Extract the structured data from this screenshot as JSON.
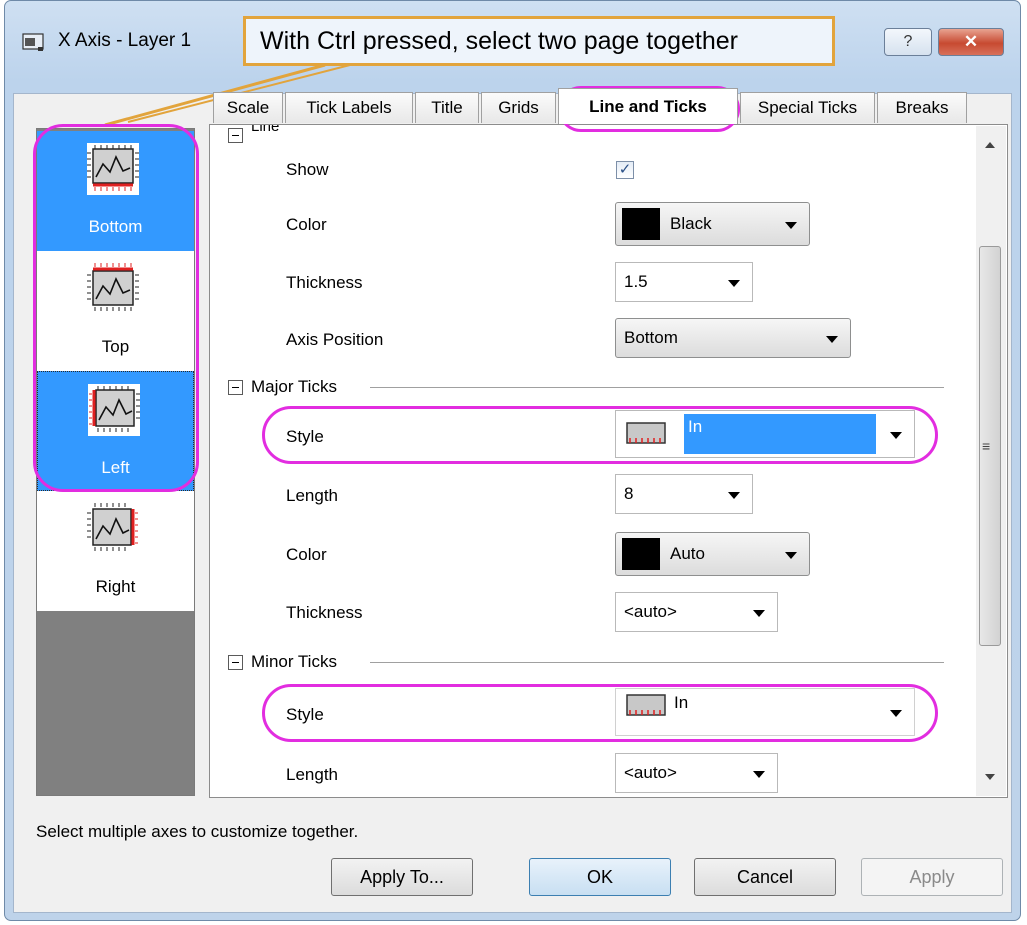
{
  "window": {
    "title": "X Axis - Layer 1",
    "help_label": "?",
    "close_label": "✕"
  },
  "callout": {
    "text": "With Ctrl pressed, select two page together"
  },
  "tabs": [
    {
      "label": "Scale"
    },
    {
      "label": "Tick Labels"
    },
    {
      "label": "Title"
    },
    {
      "label": "Grids"
    },
    {
      "label": "Line and Ticks",
      "active": true
    },
    {
      "label": "Special Ticks"
    },
    {
      "label": "Breaks"
    }
  ],
  "axes": [
    {
      "label": "Bottom",
      "selected": true,
      "icon": "axis-bottom-icon"
    },
    {
      "label": "Top",
      "selected": false,
      "icon": "axis-top-icon"
    },
    {
      "label": "Left",
      "selected": true,
      "icon": "axis-left-icon"
    },
    {
      "label": "Right",
      "selected": false,
      "icon": "axis-right-icon"
    }
  ],
  "line": {
    "header": "Line",
    "show_label": "Show",
    "show_checked": true,
    "color_label": "Color",
    "color_value": "Black",
    "thickness_label": "Thickness",
    "thickness_value": "1.5",
    "axis_position_label": "Axis Position",
    "axis_position_value": "Bottom"
  },
  "major": {
    "header": "Major Ticks",
    "style_label": "Style",
    "style_value": "In",
    "length_label": "Length",
    "length_value": "8",
    "color_label": "Color",
    "color_value": "Auto",
    "thickness_label": "Thickness",
    "thickness_value": "<auto>"
  },
  "minor": {
    "header": "Minor Ticks",
    "style_label": "Style",
    "style_value": "In",
    "length_label": "Length",
    "length_value": "<auto>"
  },
  "hint": "Select multiple axes to customize together.",
  "buttons": {
    "apply_to": "Apply To...",
    "ok": "OK",
    "cancel": "Cancel",
    "apply": "Apply"
  },
  "colors": {
    "selection": "#3399ff",
    "highlight": "#e22de0",
    "callout_border": "#e2a43c",
    "axis_red": "#e02020"
  }
}
